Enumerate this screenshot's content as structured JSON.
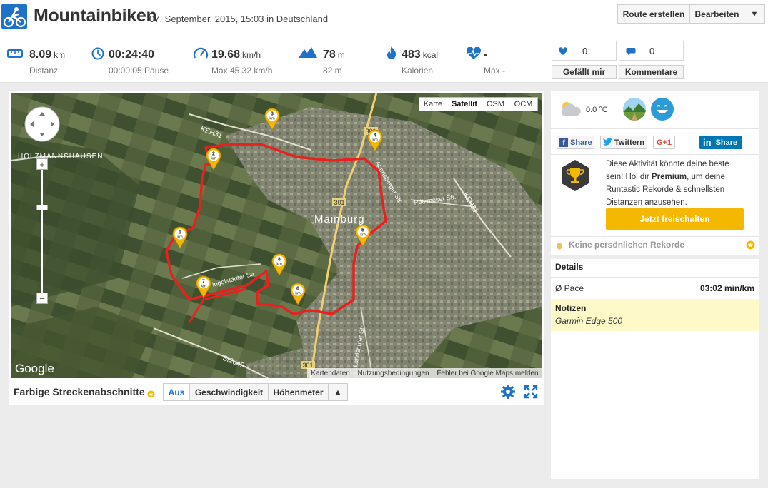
{
  "activity": {
    "title": "Mountainbiken",
    "subtitle": "07. September, 2015, 15:03 in Deutschland"
  },
  "header_buttons": {
    "create_route": "Route erstellen",
    "edit": "Bearbeiten"
  },
  "stats": {
    "distance": {
      "value": "8.09",
      "unit": "km",
      "label": "Distanz"
    },
    "duration": {
      "value": "00:24:40",
      "label": "00:00:05 Pause"
    },
    "speed": {
      "value": "19.68",
      "unit": "km/h",
      "label": "Max 45.32 km/h"
    },
    "elevation": {
      "value": "78",
      "unit": "m",
      "label": "82 m"
    },
    "calories": {
      "value": "483",
      "unit": "kcal",
      "label": "Kalorien"
    },
    "heart_rate": {
      "value": "-",
      "label": "Max -"
    }
  },
  "social": {
    "likes_count": "0",
    "comments_count": "0",
    "like_label": "Gefällt mir",
    "comment_label": "Kommentare"
  },
  "map": {
    "types": [
      "Karte",
      "Satellit",
      "OSM",
      "OCM"
    ],
    "active_type": "Satellit",
    "labels": {
      "town": "Mainburg",
      "village": "HOLZMANNSHAUSEN",
      "road_keh31_a": "KEH31",
      "road_keh31_b": "KEH31",
      "road_301_a": "301",
      "road_301_b": "301",
      "road_301_c": "301",
      "road_st2049": "St2049",
      "street_poetzmeser": "Pötzmeser Str.",
      "street_landshuter": "Landshuter Str.",
      "street_ingolstaedter": "Ingolstädter Str.",
      "street_abensberger": "Abensberger Str."
    },
    "markers": [
      "1",
      "2",
      "3",
      "4",
      "5",
      "6",
      "7",
      "8"
    ],
    "marker_unit": "km",
    "google_logo": "Google",
    "footer": {
      "data": "Kartendaten",
      "terms": "Nutzungsbedingungen",
      "report": "Fehler bei Google Maps melden"
    }
  },
  "map_controls": {
    "title": "Farbige Streckenabschnitte",
    "tabs": [
      "Aus",
      "Geschwindigkeit",
      "Höhenmeter"
    ],
    "active_tab": "Aus"
  },
  "weather": {
    "temperature": "0.0 °C"
  },
  "share": {
    "facebook": "Share",
    "twitter": "Twittern",
    "google": "G+1",
    "linkedin": "Share"
  },
  "premium": {
    "text_prefix": "Diese Aktivität könnte deine beste sein! Hol dir ",
    "text_bold": "Premium",
    "text_suffix": ", um deine Runtastic Rekorde & schnellsten Distanzen anzusehen.",
    "button": "Jetzt freischalten"
  },
  "records": {
    "label": "Keine persönlichen Rekorde"
  },
  "details": {
    "title": "Details",
    "pace_label": "Ø Pace",
    "pace_value": "03:02 min/km"
  },
  "notes": {
    "title": "Notizen",
    "text": "Garmin Edge 500"
  },
  "colors": {
    "brand_blue": "#1e73c8",
    "route_red": "#e8211f",
    "premium_yellow": "#f5b800",
    "notes_bg": "#fdf9c9"
  }
}
